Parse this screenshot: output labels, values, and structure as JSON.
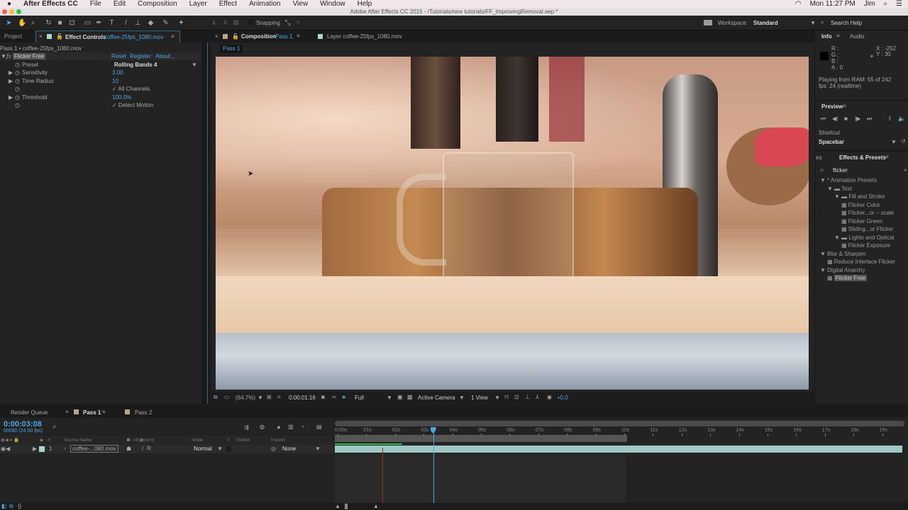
{
  "menubar": {
    "app": "After Effects CC",
    "items": [
      "File",
      "Edit",
      "Composition",
      "Layer",
      "Effect",
      "Animation",
      "View",
      "Window",
      "Help"
    ],
    "clock": "Mon 11:27 PM",
    "user": "Jim"
  },
  "titlebar": {
    "title": "Adobe After Effects CC 2015 - /Tutorials/new tutorials/FF_ImprovingRemoval.aep *"
  },
  "toolbar": {
    "snapping": "Snapping",
    "workspace_label": "Workspace:",
    "workspace": "Standard",
    "search_help": "Search Help"
  },
  "left_panel": {
    "tab_project": "Project",
    "tab_effect_controls": "Effect Controls",
    "effect_file": "coffee-25fps_1080.mov",
    "breadcrumb": "Pass 1 • coffee-25fps_1080.mov",
    "effect_name": "Flicker Free",
    "reset": "Reset",
    "register": "Register",
    "about": "About...",
    "params": [
      {
        "name": "Preset",
        "value": "Rolling Bands 4"
      },
      {
        "name": "Sensitivity",
        "value": "3.00"
      },
      {
        "name": "Time Radius",
        "value": "10"
      },
      {
        "name": "",
        "value": "✓ All Channels"
      },
      {
        "name": "Threshold",
        "value": "100.0%"
      },
      {
        "name": "",
        "value": "✓ Detect Motion"
      }
    ]
  },
  "viewer": {
    "tab_composition": "Composition",
    "comp_name": "Pass 1",
    "tab_layer": "Layer coffee-25fps_1080.mov",
    "subtab": "Pass 1",
    "zoom": "(64.7%)",
    "timecode": "0:00:01:16",
    "resolution": "Full",
    "camera": "Active Camera",
    "views": "1 View",
    "exposure": "+0.0"
  },
  "info": {
    "tab_info": "Info",
    "tab_audio": "Audio",
    "r": "R :",
    "g": "G :",
    "b": "B :",
    "a": "A : 0",
    "x": "X : -252",
    "y": "Y : 30",
    "status1": "Playing from RAM: 55 of 242",
    "status2": "fps: 24 (realtime)"
  },
  "preview": {
    "title": "Preview",
    "shortcut_label": "Shortcut",
    "shortcut": "Spacebar"
  },
  "effects": {
    "tab_prev": "es",
    "title": "Effects & Presets",
    "search": "flicker",
    "tree": [
      {
        "label": "* Animation Presets",
        "level": 0,
        "type": "group"
      },
      {
        "label": "Text",
        "level": 1,
        "type": "folder"
      },
      {
        "label": "Fill and Stroke",
        "level": 2,
        "type": "folder"
      },
      {
        "label": "Flicker Color",
        "level": 3,
        "type": "preset"
      },
      {
        "label": "Flicker...or – scale",
        "level": 3,
        "type": "preset"
      },
      {
        "label": "Flicker Green",
        "level": 3,
        "type": "preset"
      },
      {
        "label": "Sliding...or Flicker",
        "level": 3,
        "type": "preset"
      },
      {
        "label": "Lights and Optical",
        "level": 2,
        "type": "folder"
      },
      {
        "label": "Flicker Exposure",
        "level": 3,
        "type": "preset"
      },
      {
        "label": "Blur & Sharpen",
        "level": 0,
        "type": "group"
      },
      {
        "label": "Reduce Interlace Flicker",
        "level": 1,
        "type": "effect"
      },
      {
        "label": "Digital Anarchy",
        "level": 0,
        "type": "group"
      },
      {
        "label": "Flicker Free",
        "level": 1,
        "type": "effect",
        "selected": true
      }
    ]
  },
  "timeline": {
    "tab_render": "Render Queue",
    "tab_pass1": "Pass 1",
    "tab_pass2": "Pass 2",
    "timecode": "0:00:03:08",
    "frames": "00080 (24.00 fps)",
    "cols": {
      "source": "Source Name",
      "mode": "Mode",
      "t": "T",
      "trkmat": "TrkMat",
      "parent": "Parent",
      "num": "#"
    },
    "layer": {
      "index": "1",
      "name": "coffee-...080.mov",
      "mode": "Normal",
      "parent": "None"
    },
    "ruler": [
      "0:00s",
      "01s",
      "02s",
      "03s",
      "04s",
      "05s",
      "06s",
      "07s",
      "08s",
      "09s",
      "10s",
      "11s",
      "12s",
      "13s",
      "14s",
      "15s",
      "16s",
      "17s",
      "18s",
      "19s"
    ],
    "playhead_seconds": 3.33,
    "work_area_end_seconds": 10
  }
}
